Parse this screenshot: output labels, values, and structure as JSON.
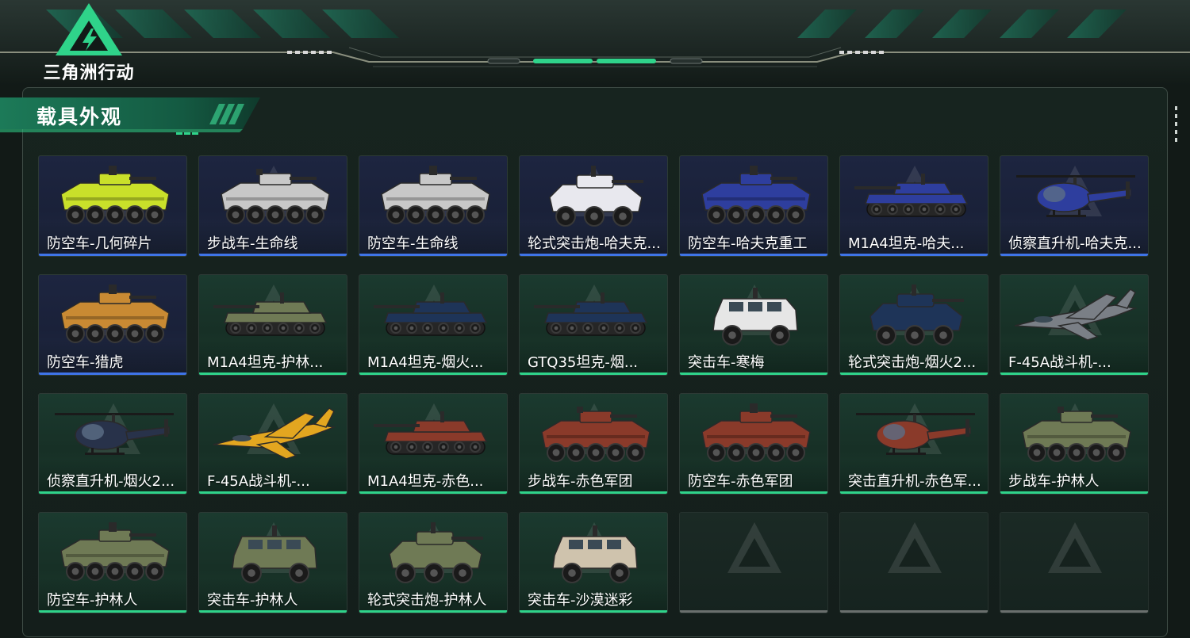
{
  "header": {
    "logo_text": "三角洲行动",
    "logo_icon": "delta-triangle-icon"
  },
  "section": {
    "title": "载具外观"
  },
  "colors": {
    "rarity_blue": "#3f74e8",
    "rarity_green": "#2fd38a",
    "empty_slot": "#6a6f6d",
    "accent": "#2fd38a"
  },
  "skins": [
    {
      "label": "防空车-几何碎片",
      "rarity": "blue",
      "vehicle": "wheeled-aa-vehicle",
      "color": "#c9e02a"
    },
    {
      "label": "步战车-生命线",
      "rarity": "blue",
      "vehicle": "wheeled-ifv",
      "color": "#c8c8c8"
    },
    {
      "label": "防空车-生命线",
      "rarity": "blue",
      "vehicle": "wheeled-aa-vehicle",
      "color": "#c8c8c8"
    },
    {
      "label": "轮式突击炮-哈夫克...",
      "rarity": "blue",
      "vehicle": "wheeled-assault-gun",
      "color": "#e8e8ee"
    },
    {
      "label": "防空车-哈夫克重工",
      "rarity": "blue",
      "vehicle": "wheeled-aa-vehicle",
      "color": "#2e3e9e"
    },
    {
      "label": "M1A4坦克-哈夫...",
      "rarity": "blue",
      "vehicle": "tank",
      "color": "#2e3e9e"
    },
    {
      "label": "侦察直升机-哈夫克...",
      "rarity": "blue",
      "vehicle": "helicopter",
      "color": "#2e3e9e"
    },
    {
      "label": "防空车-猎虎",
      "rarity": "blue",
      "vehicle": "wheeled-aa-vehicle",
      "color": "#c98a33"
    },
    {
      "label": "M1A4坦克-护林...",
      "rarity": "green",
      "vehicle": "tank",
      "color": "#6f7a55"
    },
    {
      "label": "M1A4坦克-烟火...",
      "rarity": "green",
      "vehicle": "tank",
      "color": "#1e3458"
    },
    {
      "label": "GTQ35坦克-烟...",
      "rarity": "green",
      "vehicle": "tank",
      "color": "#1e3458"
    },
    {
      "label": "突击车-寒梅",
      "rarity": "green",
      "vehicle": "armored-car",
      "color": "#e6e6e6"
    },
    {
      "label": "轮式突击炮-烟火2...",
      "rarity": "green",
      "vehicle": "wheeled-assault-gun",
      "color": "#1e3458"
    },
    {
      "label": "F-45A战斗机-...",
      "rarity": "green",
      "vehicle": "fighter-jet",
      "color": "#7a7f86"
    },
    {
      "label": "侦察直升机-烟火2...",
      "rarity": "green",
      "vehicle": "helicopter",
      "color": "#28324a"
    },
    {
      "label": "F-45A战斗机-...",
      "rarity": "green",
      "vehicle": "fighter-jet",
      "color": "#e3a620"
    },
    {
      "label": "M1A4坦克-赤色...",
      "rarity": "green",
      "vehicle": "tank",
      "color": "#8a3a2a"
    },
    {
      "label": "步战车-赤色军团",
      "rarity": "green",
      "vehicle": "wheeled-ifv",
      "color": "#8a3a2a"
    },
    {
      "label": "防空车-赤色军团",
      "rarity": "green",
      "vehicle": "wheeled-aa-vehicle",
      "color": "#8a3a2a"
    },
    {
      "label": "突击直升机-赤色军...",
      "rarity": "green",
      "vehicle": "attack-helicopter",
      "color": "#8a3a2a"
    },
    {
      "label": "步战车-护林人",
      "rarity": "green",
      "vehicle": "wheeled-ifv",
      "color": "#6f7a55"
    },
    {
      "label": "防空车-护林人",
      "rarity": "green",
      "vehicle": "wheeled-aa-vehicle",
      "color": "#6f7a55"
    },
    {
      "label": "突击车-护林人",
      "rarity": "green",
      "vehicle": "armored-car",
      "color": "#6f7a55"
    },
    {
      "label": "轮式突击炮-护林人",
      "rarity": "green",
      "vehicle": "wheeled-assault-gun",
      "color": "#6f7a55"
    },
    {
      "label": "突击车-沙漠迷彩",
      "rarity": "green",
      "vehicle": "armored-car",
      "color": "#cfc3ad"
    },
    {
      "label": "",
      "rarity": "empty",
      "vehicle": "",
      "color": ""
    },
    {
      "label": "",
      "rarity": "empty",
      "vehicle": "",
      "color": ""
    },
    {
      "label": "",
      "rarity": "empty",
      "vehicle": "",
      "color": ""
    }
  ]
}
